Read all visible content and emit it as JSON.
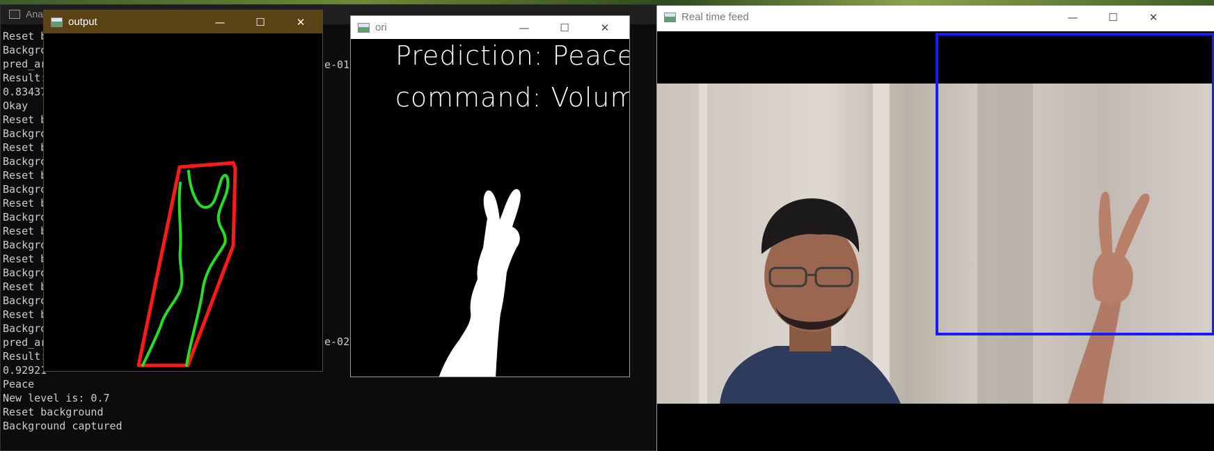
{
  "console": {
    "title": "Ana",
    "lines": [
      "Reset b",
      "Backgro",
      "pred_ar",
      "Result:",
      "0.83437",
      "Okay",
      "Reset b",
      "Backgro",
      "Reset b",
      "Backgro",
      "Reset b",
      "Backgro",
      "Reset b",
      "Backgro",
      "Reset b",
      "Backgro",
      "Reset b",
      "Backgro",
      "Reset b",
      "Backgro",
      "Reset b",
      "Backgro",
      "pred_ar",
      "Result:",
      "0.92921",
      "Peace",
      "New level is: 0.7",
      "Reset background",
      "Background captured"
    ],
    "fragment_1": "e-01",
    "fragment_2": "e-02"
  },
  "windows": {
    "output": {
      "title": "output",
      "minimize": "—",
      "maximize": "☐",
      "close": "✕"
    },
    "ori": {
      "title": "ori",
      "minimize": "—",
      "maximize": "☐",
      "close": "✕",
      "prediction_line": "Prediction: Peace",
      "command_line": "command: Volum"
    },
    "feed": {
      "title": "Real time feed",
      "minimize": "—",
      "maximize": "☐",
      "close": "✕"
    }
  },
  "colors": {
    "output_titlebar": "#5c4316",
    "hull": "#ff1a1a",
    "contour": "#22e022",
    "roi_box": "#1a1aff"
  },
  "icons": [
    "window-icon",
    "minimize-icon",
    "maximize-icon",
    "close-icon"
  ]
}
